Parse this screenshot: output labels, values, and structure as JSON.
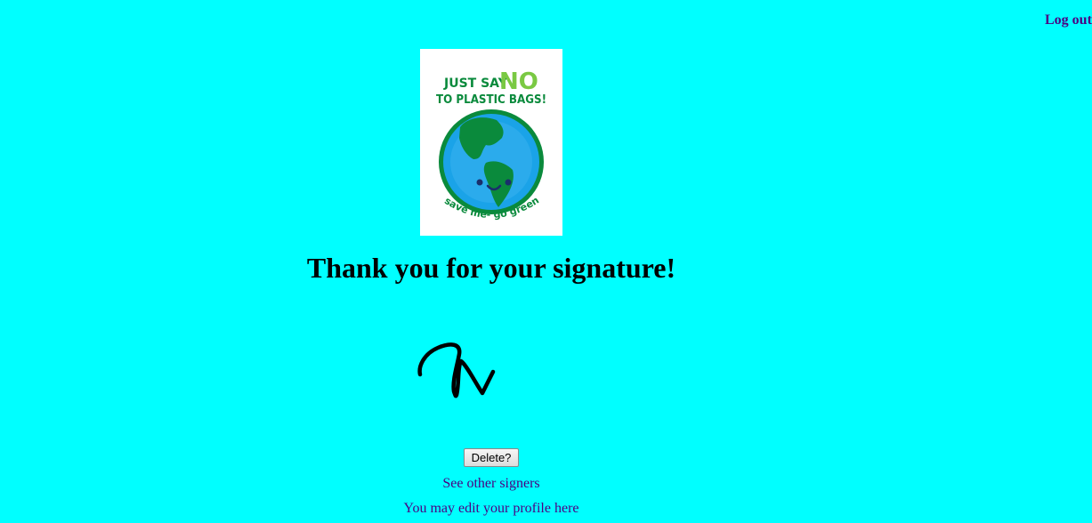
{
  "header": {
    "logout_label": "Log out"
  },
  "poster": {
    "line1": "JUST SAY",
    "line1_emphasis": "NO",
    "line2": "TO PLASTIC BAGS!",
    "footer": "save me- go green"
  },
  "main": {
    "title": "Thank you for your signature!",
    "delete_label": "Delete?",
    "see_signers_label": "See other signers",
    "edit_profile_label": "You may edit your profile here"
  },
  "colors": {
    "background": "#00ffff",
    "link": "#4b0082",
    "poster_green": "#0a8a3c",
    "poster_lime": "#7ac943",
    "earth_blue": "#1aa3e8"
  }
}
